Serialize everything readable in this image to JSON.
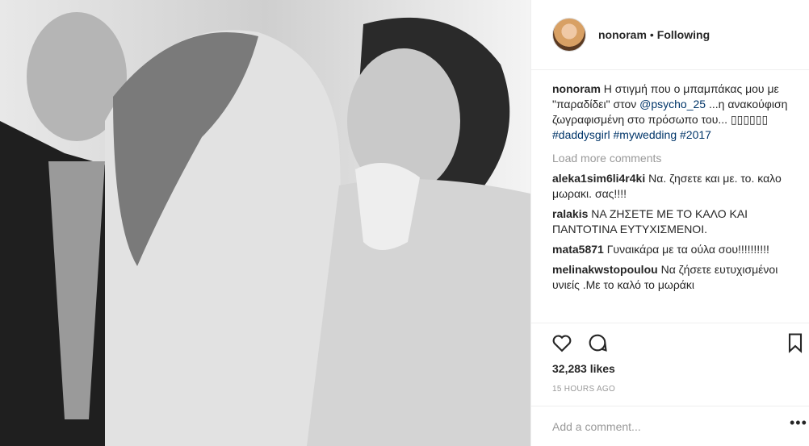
{
  "post": {
    "photo_alt": "photo",
    "author": "nonoram",
    "separator": "•",
    "follow_status": "Following"
  },
  "caption": {
    "username": "nonoram",
    "text_1": "Η στιγμή που ο μπαμπάκας μου με \"παραδίδει\" στον ",
    "mention": "@psycho_25",
    "text_2": " ...η ανακούφιση ζωγραφισμένη στο πρόσωπο του... ▯▯▯▯▯▯ ",
    "tag_1": "#daddysgirl",
    "tag_2": "#mywedding",
    "tag_3": "#2017"
  },
  "load_more": "Load more comments",
  "comments": [
    {
      "username": "aleka1sim6li4r4ki",
      "text": "Να. ζησετε και με. το. καλο μωρακι. σας!!!!"
    },
    {
      "username": "ralakis",
      "text": "ΝΑ ΖΗΣΕΤΕ ΜΕ ΤΟ ΚΑΛΟ ΚΑΙ ΠΑΝΤΟΤΙΝΑ ΕΥΤΥΧΙΣΜΕΝΟΙ."
    },
    {
      "username": "mata5871",
      "text": "Γυναικάρα με τα ούλα σου!!!!!!!!!!"
    },
    {
      "username": "melinakwstopoulou",
      "text": "Να ζήσετε ευτυχισμένοι υνιείς .Με το καλό το μωράκι"
    }
  ],
  "icons": {
    "like": "heart-icon",
    "comment": "comment-icon",
    "save": "bookmark-icon",
    "more": "more-options-icon"
  },
  "likes": "32,283 likes",
  "timestamp": "15 HOURS AGO",
  "add_comment": {
    "placeholder": "Add a comment...",
    "more": "•••"
  },
  "colors": {
    "link": "#003569",
    "muted": "#999999",
    "text": "#262626"
  }
}
